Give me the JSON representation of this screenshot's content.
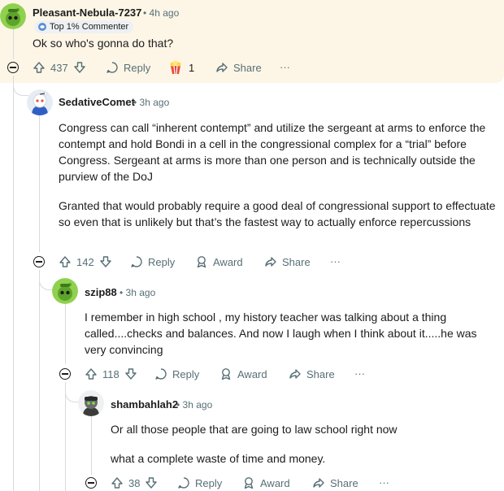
{
  "comments": [
    {
      "author": "Pleasant-Nebula-7237",
      "time": "4h ago",
      "flair": "Top 1% Commenter",
      "paragraphs": [
        "Ok so who's gonna do that?"
      ],
      "votes": "437",
      "reply": "Reply",
      "award_count": "1",
      "share": "Share",
      "more": "···"
    },
    {
      "author": "SedativeComet",
      "time": "3h ago",
      "paragraphs": [
        "Congress can call “inherent contempt” and utilize the sergeant at arms to enforce the contempt and hold Bondi in a cell in the congressional complex for a “trial” before Congress. Sergeant at arms is more than one person and is technically outside the purview of the DoJ",
        "Granted that would probably require a good deal of congressional support to effectuate so even that is unlikely but that’s the fastest way to actually enforce repercussions"
      ],
      "votes": "142",
      "reply": "Reply",
      "award": "Award",
      "share": "Share",
      "more": "···"
    },
    {
      "author": "szip88",
      "time": "3h ago",
      "paragraphs": [
        "I remember in high school ,  my history teacher was talking about a thing called....checks and balances. And now I laugh when I think about it.....he was very convincing"
      ],
      "votes": "118",
      "reply": "Reply",
      "award": "Award",
      "share": "Share",
      "more": "···"
    },
    {
      "author": "shambahlah2",
      "time": "3h ago",
      "paragraphs": [
        "Or all those people that are going to law school right now",
        "what a complete waste of time and money."
      ],
      "votes": "38",
      "reply": "Reply",
      "award": "Award",
      "share": "Share",
      "more": "···"
    }
  ],
  "separator": "•"
}
